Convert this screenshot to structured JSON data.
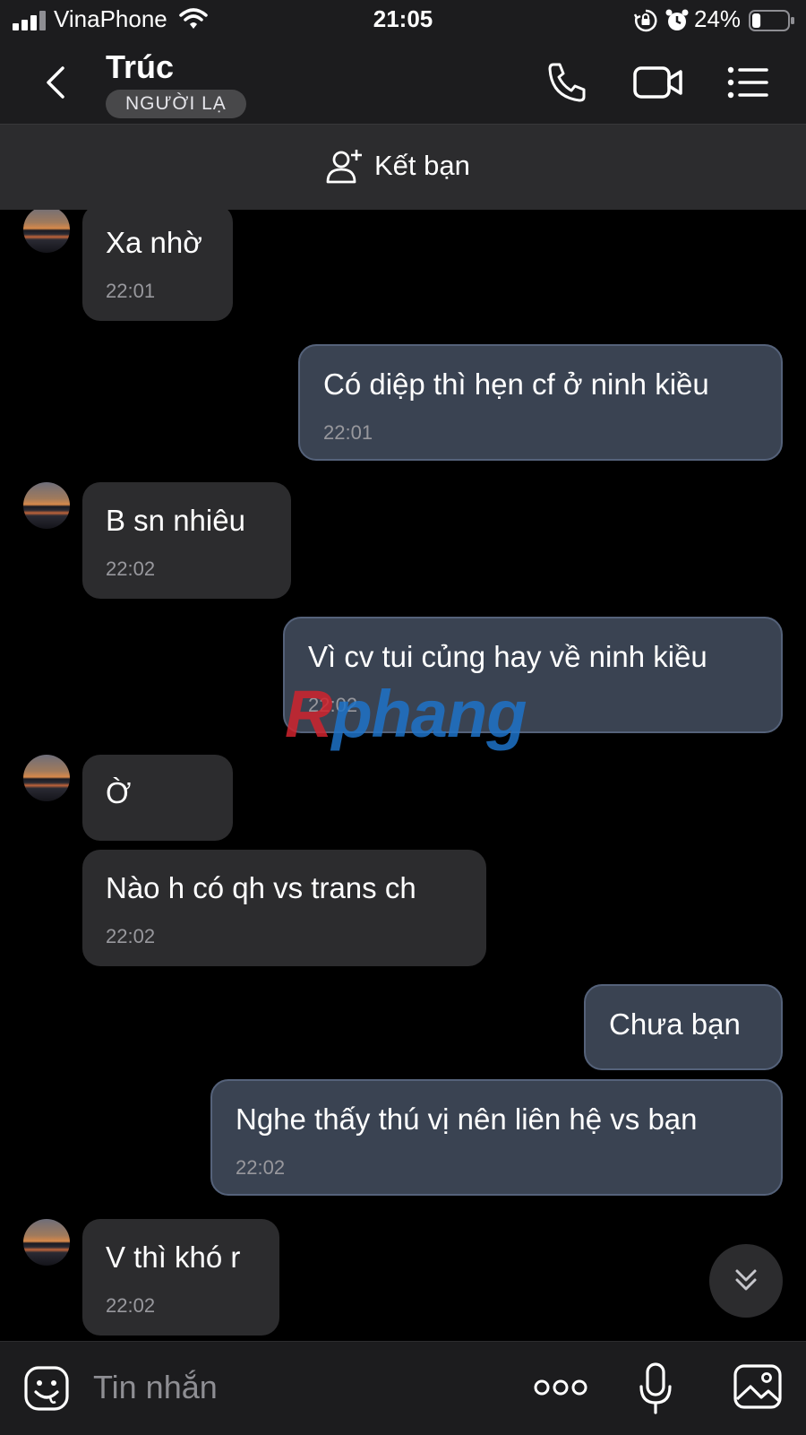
{
  "status_bar": {
    "carrier": "VinaPhone",
    "time": "21:05",
    "battery_percent": "24%",
    "battery_level": 0.24,
    "icons": [
      "signal-icon",
      "wifi-icon",
      "rotation-lock-icon",
      "alarm-icon",
      "battery-icon"
    ]
  },
  "header": {
    "contact_name": "Trúc",
    "badge": "NGƯỜI LẠ",
    "icons": [
      "back-icon",
      "phone-icon",
      "video-icon",
      "list-icon"
    ]
  },
  "add_friend": {
    "label": "Kết bạn",
    "icon": "add-user-icon"
  },
  "messages": [
    {
      "direction": "in",
      "text": "Xa nhờ",
      "time": "22:01",
      "avatar": true
    },
    {
      "direction": "out",
      "text": "Có diệp thì hẹn cf ở ninh kiều",
      "time": "22:01"
    },
    {
      "direction": "in",
      "text": "B sn nhiêu",
      "time": "22:02",
      "avatar": true
    },
    {
      "direction": "out",
      "text": "Vì cv tui củng hay về ninh kiều",
      "time": "22:02"
    },
    {
      "direction": "in",
      "text": "Ờ",
      "time": "",
      "avatar": true
    },
    {
      "direction": "in",
      "text": "Nào h có qh vs trans ch",
      "time": "22:02"
    },
    {
      "direction": "out",
      "text": "Chưa bạn",
      "time": ""
    },
    {
      "direction": "out",
      "text": "Nghe thấy thú vị nên liên hệ vs bạn",
      "time": "22:02"
    },
    {
      "direction": "in",
      "text": "V thì khó r",
      "time": "22:02",
      "avatar": true
    }
  ],
  "watermark": {
    "part1": "R",
    "part2": "phang"
  },
  "input_bar": {
    "placeholder": "Tin nhắn",
    "icons": [
      "emoji-icon",
      "more-icon",
      "microphone-icon",
      "image-icon"
    ]
  },
  "colors": {
    "background": "#000000",
    "header": "#1c1c1e",
    "incoming_bubble": "#2c2c2e",
    "outgoing_bubble": "#3a4352",
    "timestamp": "#98989d"
  }
}
